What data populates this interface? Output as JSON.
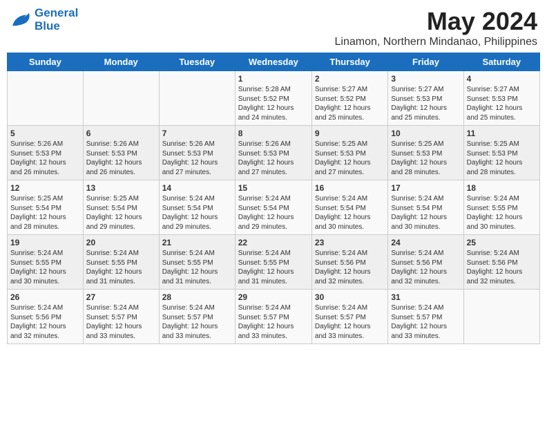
{
  "header": {
    "logo_line1": "General",
    "logo_line2": "Blue",
    "title": "May 2024",
    "subtitle": "Linamon, Northern Mindanao, Philippines"
  },
  "days": [
    "Sunday",
    "Monday",
    "Tuesday",
    "Wednesday",
    "Thursday",
    "Friday",
    "Saturday"
  ],
  "weeks": [
    [
      {
        "date": "",
        "info": ""
      },
      {
        "date": "",
        "info": ""
      },
      {
        "date": "",
        "info": ""
      },
      {
        "date": "1",
        "info": "Sunrise: 5:28 AM\nSunset: 5:52 PM\nDaylight: 12 hours\nand 24 minutes."
      },
      {
        "date": "2",
        "info": "Sunrise: 5:27 AM\nSunset: 5:52 PM\nDaylight: 12 hours\nand 25 minutes."
      },
      {
        "date": "3",
        "info": "Sunrise: 5:27 AM\nSunset: 5:53 PM\nDaylight: 12 hours\nand 25 minutes."
      },
      {
        "date": "4",
        "info": "Sunrise: 5:27 AM\nSunset: 5:53 PM\nDaylight: 12 hours\nand 25 minutes."
      }
    ],
    [
      {
        "date": "5",
        "info": "Sunrise: 5:26 AM\nSunset: 5:53 PM\nDaylight: 12 hours\nand 26 minutes."
      },
      {
        "date": "6",
        "info": "Sunrise: 5:26 AM\nSunset: 5:53 PM\nDaylight: 12 hours\nand 26 minutes."
      },
      {
        "date": "7",
        "info": "Sunrise: 5:26 AM\nSunset: 5:53 PM\nDaylight: 12 hours\nand 27 minutes."
      },
      {
        "date": "8",
        "info": "Sunrise: 5:26 AM\nSunset: 5:53 PM\nDaylight: 12 hours\nand 27 minutes."
      },
      {
        "date": "9",
        "info": "Sunrise: 5:25 AM\nSunset: 5:53 PM\nDaylight: 12 hours\nand 27 minutes."
      },
      {
        "date": "10",
        "info": "Sunrise: 5:25 AM\nSunset: 5:53 PM\nDaylight: 12 hours\nand 28 minutes."
      },
      {
        "date": "11",
        "info": "Sunrise: 5:25 AM\nSunset: 5:53 PM\nDaylight: 12 hours\nand 28 minutes."
      }
    ],
    [
      {
        "date": "12",
        "info": "Sunrise: 5:25 AM\nSunset: 5:54 PM\nDaylight: 12 hours\nand 28 minutes."
      },
      {
        "date": "13",
        "info": "Sunrise: 5:25 AM\nSunset: 5:54 PM\nDaylight: 12 hours\nand 29 minutes."
      },
      {
        "date": "14",
        "info": "Sunrise: 5:24 AM\nSunset: 5:54 PM\nDaylight: 12 hours\nand 29 minutes."
      },
      {
        "date": "15",
        "info": "Sunrise: 5:24 AM\nSunset: 5:54 PM\nDaylight: 12 hours\nand 29 minutes."
      },
      {
        "date": "16",
        "info": "Sunrise: 5:24 AM\nSunset: 5:54 PM\nDaylight: 12 hours\nand 30 minutes."
      },
      {
        "date": "17",
        "info": "Sunrise: 5:24 AM\nSunset: 5:54 PM\nDaylight: 12 hours\nand 30 minutes."
      },
      {
        "date": "18",
        "info": "Sunrise: 5:24 AM\nSunset: 5:55 PM\nDaylight: 12 hours\nand 30 minutes."
      }
    ],
    [
      {
        "date": "19",
        "info": "Sunrise: 5:24 AM\nSunset: 5:55 PM\nDaylight: 12 hours\nand 30 minutes."
      },
      {
        "date": "20",
        "info": "Sunrise: 5:24 AM\nSunset: 5:55 PM\nDaylight: 12 hours\nand 31 minutes."
      },
      {
        "date": "21",
        "info": "Sunrise: 5:24 AM\nSunset: 5:55 PM\nDaylight: 12 hours\nand 31 minutes."
      },
      {
        "date": "22",
        "info": "Sunrise: 5:24 AM\nSunset: 5:55 PM\nDaylight: 12 hours\nand 31 minutes."
      },
      {
        "date": "23",
        "info": "Sunrise: 5:24 AM\nSunset: 5:56 PM\nDaylight: 12 hours\nand 32 minutes."
      },
      {
        "date": "24",
        "info": "Sunrise: 5:24 AM\nSunset: 5:56 PM\nDaylight: 12 hours\nand 32 minutes."
      },
      {
        "date": "25",
        "info": "Sunrise: 5:24 AM\nSunset: 5:56 PM\nDaylight: 12 hours\nand 32 minutes."
      }
    ],
    [
      {
        "date": "26",
        "info": "Sunrise: 5:24 AM\nSunset: 5:56 PM\nDaylight: 12 hours\nand 32 minutes."
      },
      {
        "date": "27",
        "info": "Sunrise: 5:24 AM\nSunset: 5:57 PM\nDaylight: 12 hours\nand 33 minutes."
      },
      {
        "date": "28",
        "info": "Sunrise: 5:24 AM\nSunset: 5:57 PM\nDaylight: 12 hours\nand 33 minutes."
      },
      {
        "date": "29",
        "info": "Sunrise: 5:24 AM\nSunset: 5:57 PM\nDaylight: 12 hours\nand 33 minutes."
      },
      {
        "date": "30",
        "info": "Sunrise: 5:24 AM\nSunset: 5:57 PM\nDaylight: 12 hours\nand 33 minutes."
      },
      {
        "date": "31",
        "info": "Sunrise: 5:24 AM\nSunset: 5:57 PM\nDaylight: 12 hours\nand 33 minutes."
      },
      {
        "date": "",
        "info": ""
      }
    ]
  ]
}
